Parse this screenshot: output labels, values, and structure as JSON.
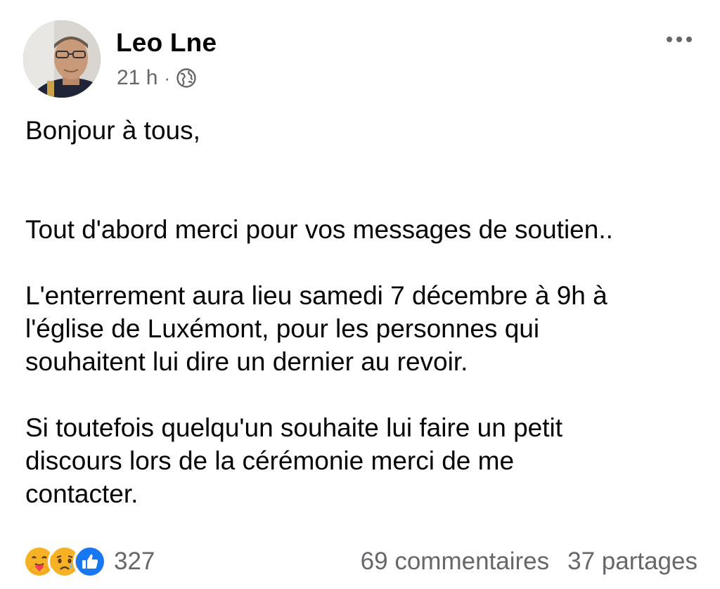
{
  "post": {
    "author": "Leo Lne",
    "time": "21 h",
    "separator": "·",
    "audience_icon": "globe-icon",
    "paragraphs": [
      "Bonjour à tous,",
      "Tout d'abord merci pour vos messages de soutien..",
      "L'enterrement aura lieu samedi 7 décembre à 9h à\nl'église de Luxémont, pour les personnes qui\nsouhaitent lui dire un dernier au revoir.",
      "Si toutefois quelqu'un souhaite lui faire un petit\ndiscours lors de la cérémonie merci de me\ncontacter."
    ]
  },
  "footer": {
    "reaction_icons": [
      "care-reaction-icon",
      "sad-reaction-icon",
      "like-reaction-icon"
    ],
    "reaction_count": "327",
    "comments": "69 commentaires",
    "shares": "37 partages"
  },
  "colors": {
    "text": "#050505",
    "secondary": "#65676b",
    "like_blue": "#1877f2",
    "emoji_yellow": "#f7b125"
  }
}
